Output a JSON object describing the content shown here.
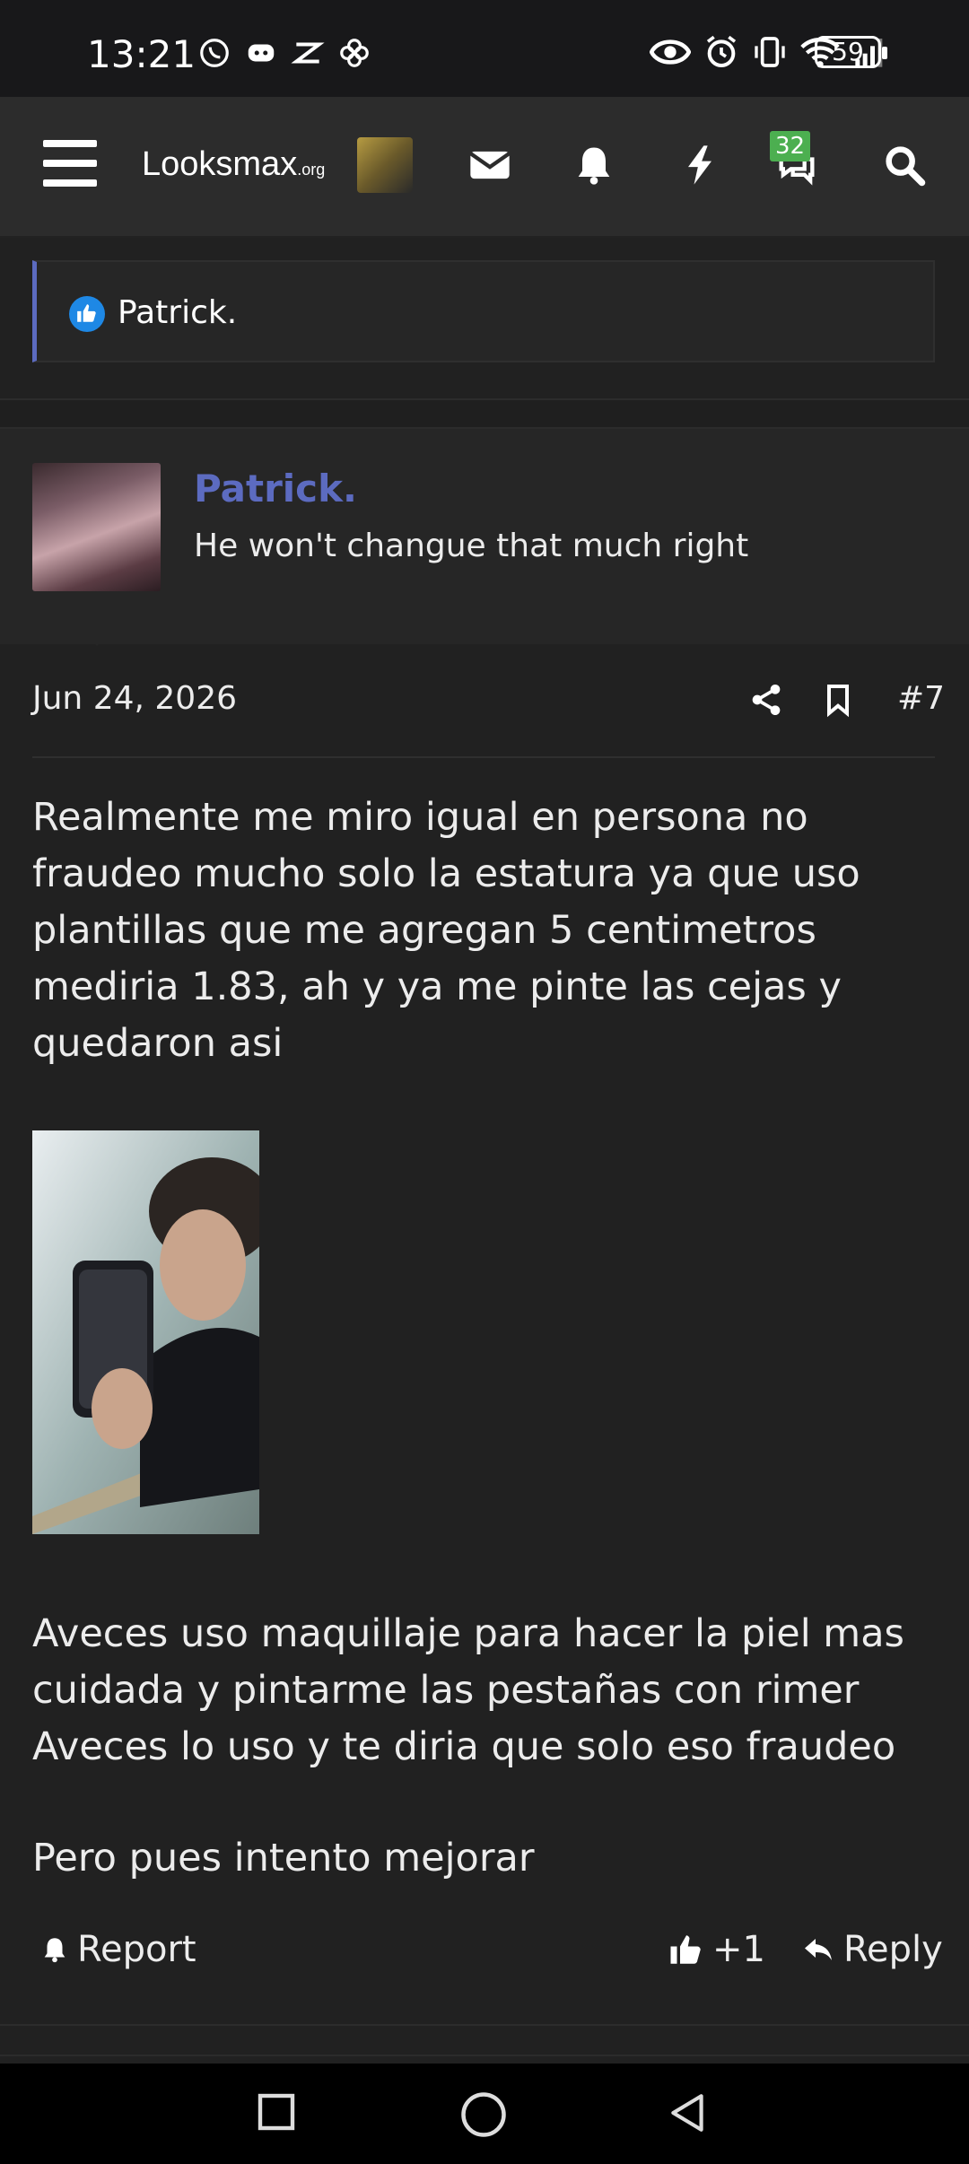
{
  "status_bar": {
    "time": "13:21",
    "battery": "59",
    "left_icons": [
      "whatsapp-icon",
      "discord-icon",
      "capcut-icon",
      "pinwheel-icon"
    ],
    "right_icons": [
      "eye-icon",
      "alarm-icon",
      "vibrate-icon",
      "wifi-icon",
      "signal-icon"
    ]
  },
  "header": {
    "logo_main": "Looksmax",
    "logo_suffix": ".org",
    "messages_badge": "32",
    "icons": [
      "menu-icon",
      "mail-icon",
      "bell-icon",
      "bolt-icon",
      "chat-icon",
      "search-icon"
    ]
  },
  "reaction": {
    "name": "Patrick."
  },
  "post": {
    "author": "Patrick.",
    "author_title": "He won't changue that much right",
    "date": "Jun 24, 2026",
    "number": "#7",
    "paragraph1": "Realmente me miro igual en persona no fraudeo mucho solo la estatura ya que uso plantillas que me agregan 5 centimetros mediria 1.83, ah y ya me pinte las cejas y quedaron asi",
    "paragraph2_line1": "Aveces uso maquillaje para hacer la piel mas cuidada y pintarme las pestañas con rimer",
    "paragraph2_line2": "Aveces lo uso y te diria que solo eso fraudeo",
    "paragraph3": "Pero pues intento mejorar"
  },
  "actions": {
    "report": "Report",
    "like": "+1",
    "reply": "Reply"
  },
  "colors": {
    "accent": "#5c6bc0",
    "background": "#212121",
    "header": "#2c2c2c",
    "badge": "#4caf50"
  }
}
